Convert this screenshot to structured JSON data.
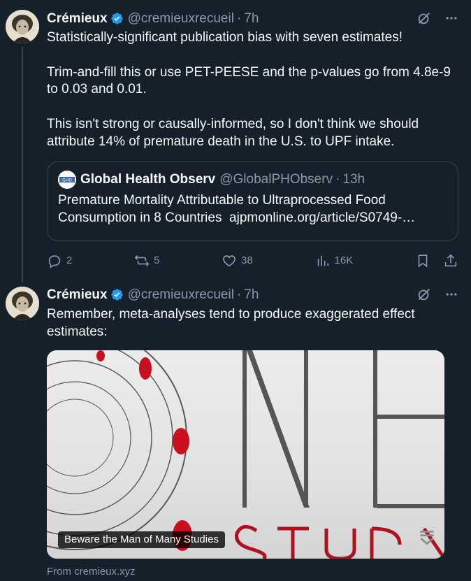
{
  "tweets": [
    {
      "author_name": "Crémieux",
      "author_handle": "@cremieuxrecueil",
      "time": "7h",
      "text": "Statistically-significant publication bias with seven estimates!\n\nTrim-and-fill this or use PET-PEESE and the p-values go from 4.8e-9 to 0.03 and 0.01.\n\nThis isn't strong or causally-informed, so I don't think we should attribute 14% of premature death in the U.S. to UPF intake.",
      "quote": {
        "avatar_text": "GHO",
        "name": "Global Health Observ",
        "handle": "@GlobalPHObserv",
        "time": "13h",
        "text": "Premature Mortality Attributable to Ultraprocessed Food Consumption in 8 Countries",
        "link": "ajpmonline.org/article/S0749-…"
      },
      "actions": {
        "replies": "2",
        "reposts": "5",
        "likes": "38",
        "views": "16K"
      }
    },
    {
      "author_name": "Crémieux",
      "author_handle": "@cremieuxrecueil",
      "time": "7h",
      "text": "Remember, meta-analyses tend to produce exaggerated effect estimates:",
      "card": {
        "title": "Beware the Man of Many Studies",
        "image_text": "ONE STUDY",
        "source": "From cremieux.xyz"
      }
    }
  ],
  "icons": {
    "verified": "verified-badge-icon",
    "grok": "grok-icon",
    "more": "more-icon",
    "reply": "reply-icon",
    "repost": "repost-icon",
    "like": "like-icon",
    "views": "views-icon",
    "bookmark": "bookmark-icon",
    "share": "share-icon"
  },
  "colors": {
    "background": "#15202b",
    "text": "#f7f9f9",
    "secondary": "#8b98a5",
    "border": "#38444d",
    "verified": "#1d9bf0"
  }
}
